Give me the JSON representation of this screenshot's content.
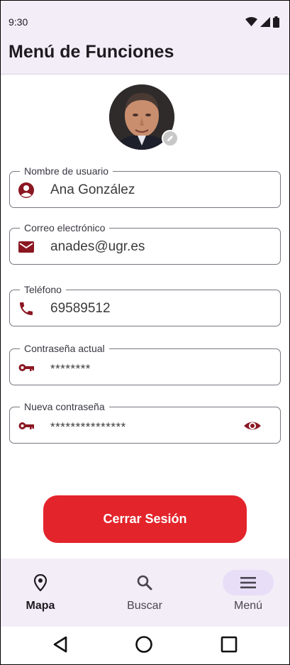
{
  "status_bar": {
    "time": "9:30",
    "icons": [
      "wifi-icon",
      "signal-icon",
      "battery-icon"
    ]
  },
  "app_bar": {
    "title": "Menú de Funciones"
  },
  "profile": {
    "avatar_icon": "user-photo",
    "edit_icon": "pencil-icon"
  },
  "fields": {
    "username": {
      "label": "Nombre de usuario",
      "value": "Ana González",
      "icon": "account-circle-icon"
    },
    "email": {
      "label": "Correo electrónico",
      "value": "anades@ugr.es",
      "icon": "mail-icon"
    },
    "phone": {
      "label": "Teléfono",
      "value": "69589512",
      "icon": "phone-icon"
    },
    "current_password": {
      "label": "Contraseña actual",
      "value": "********",
      "icon": "key-icon"
    },
    "new_password": {
      "label": "Nueva contraseña",
      "value": "***************",
      "icon": "key-icon",
      "toggle_icon": "eye-icon"
    }
  },
  "logout": {
    "label": "Cerrar Sesión"
  },
  "bottom_nav": {
    "items": [
      {
        "label": "Mapa",
        "icon": "location-pin-icon"
      },
      {
        "label": "Buscar",
        "icon": "search-icon"
      },
      {
        "label": "Menú",
        "icon": "menu-icon"
      }
    ]
  },
  "system_nav": {
    "icons": [
      "back-icon",
      "home-icon",
      "recents-icon"
    ]
  },
  "colors": {
    "accent": "#8b1722",
    "button": "#e3242b",
    "surface_tint": "#f3edf7",
    "nav_indicator": "#e8def8"
  }
}
